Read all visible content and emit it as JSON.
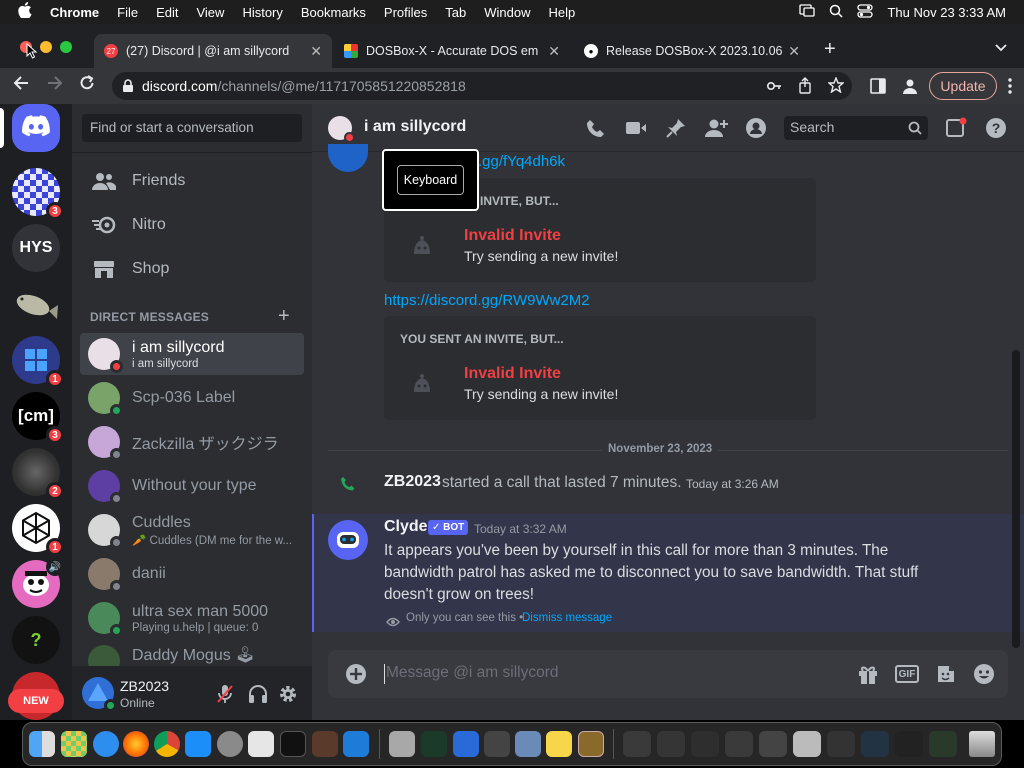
{
  "menubar": {
    "app_name": "Chrome",
    "menus": [
      "File",
      "Edit",
      "View",
      "History",
      "Bookmarks",
      "Profiles",
      "Tab",
      "Window",
      "Help"
    ],
    "clock": "Thu Nov 23  3:33 AM"
  },
  "tabs": [
    {
      "title": "(27) Discord | @i am sillycord",
      "favicon": "discord-favicon",
      "badge": "27",
      "active": true
    },
    {
      "title": "DOSBox-X - Accurate DOS em",
      "favicon": "dosbox-favicon",
      "active": false
    },
    {
      "title": "Release DOSBox-X 2023.10.06",
      "favicon": "github-favicon",
      "active": false
    }
  ],
  "address": {
    "host": "discord.com",
    "path": "/channels/@me/1171705851220852818",
    "update_label": "Update"
  },
  "servers": {
    "items": [
      {
        "name": "discord-home",
        "text": ""
      },
      {
        "name": "server-1",
        "text": "",
        "badge": "3"
      },
      {
        "name": "server-hys",
        "text": "HYS"
      },
      {
        "name": "server-3",
        "text": ""
      },
      {
        "name": "server-4",
        "text": "",
        "badge": "1"
      },
      {
        "name": "server-cm",
        "text": "[cm]",
        "badge": "3"
      },
      {
        "name": "server-6",
        "text": "",
        "badge": "2"
      },
      {
        "name": "server-7",
        "text": "",
        "badge": "1"
      },
      {
        "name": "server-8",
        "text": ""
      },
      {
        "name": "server-9",
        "text": "?"
      },
      {
        "name": "server-10",
        "text": ""
      }
    ],
    "new_label": "NEW"
  },
  "sidebar": {
    "search_placeholder": "Find or start a conversation",
    "nav": [
      {
        "label": "Friends",
        "icon": "friends-icon"
      },
      {
        "label": "Nitro",
        "icon": "nitro-icon"
      },
      {
        "label": "Shop",
        "icon": "shop-icon"
      }
    ],
    "dm_header": "DIRECT MESSAGES",
    "dms": [
      {
        "name": "i am sillycord",
        "sub": "i am sillycord",
        "status": "dnd",
        "active": true,
        "color": "#e8e0e6"
      },
      {
        "name": "Scp-036 Label",
        "sub": "",
        "status": "online",
        "active": false,
        "color": "#7aa36a"
      },
      {
        "name": "Zackzilla ザックジラ",
        "sub": "",
        "status": "offline",
        "active": false,
        "color": "#c7a6d8"
      },
      {
        "name": "Without your type",
        "sub": "",
        "status": "offline",
        "active": false,
        "color": "#5d3fa3"
      },
      {
        "name": "Cuddles",
        "sub": "🥕 Cuddles (DM me for the w...",
        "status": "offline",
        "active": false,
        "color": "#d7d7d7"
      },
      {
        "name": "danii",
        "sub": "",
        "status": "offline",
        "active": false,
        "color": "#8a7a6c"
      },
      {
        "name": "ultra sex man 5000",
        "sub": "Playing u.help | queue: 0",
        "status": "online",
        "active": false,
        "color": "#4a8a5a"
      },
      {
        "name": "Daddy Mogus 🕹",
        "sub": "",
        "status": "offline",
        "active": false,
        "color": "#3a5a3a"
      }
    ],
    "user": {
      "name": "ZB2023",
      "status": "Online"
    }
  },
  "channel": {
    "name": "i am sillycord",
    "search_placeholder": "Search",
    "tooltip": "Keyboard"
  },
  "messages": {
    "link1": ".gg/fYq4dh6k",
    "invite1_title": "INVITE, BUT...",
    "invalid_label": "Invalid Invite",
    "invalid_sub": "Try sending a new invite!",
    "link2": "https://discord.gg/RW9Ww2M2",
    "invite2_title": "YOU SENT AN INVITE, BUT...",
    "date_divider": "November 23, 2023",
    "call": {
      "user": "ZB2023",
      "text": "started a call that lasted 7 minutes.",
      "time": "Today at 3:26 AM"
    },
    "clyde": {
      "name": "Clyde",
      "tag": "BOT",
      "time": "Today at 3:32 AM",
      "line1": "It appears you've been by yourself in this call for more than 3 minutes. The",
      "line2": "bandwidth patrol has asked me to disconnect you to save bandwidth. That stuff",
      "line3": "doesn't grow on trees!",
      "only_you": "Only you can see this •",
      "dismiss": "Dismiss message"
    }
  },
  "composer": {
    "placeholder": "Message @i am sillycord",
    "gif_label": "GIF"
  },
  "colors": {
    "blurple": "#5865f2",
    "danger": "#f23f43",
    "online": "#23a55a",
    "link": "#00a8fc"
  }
}
